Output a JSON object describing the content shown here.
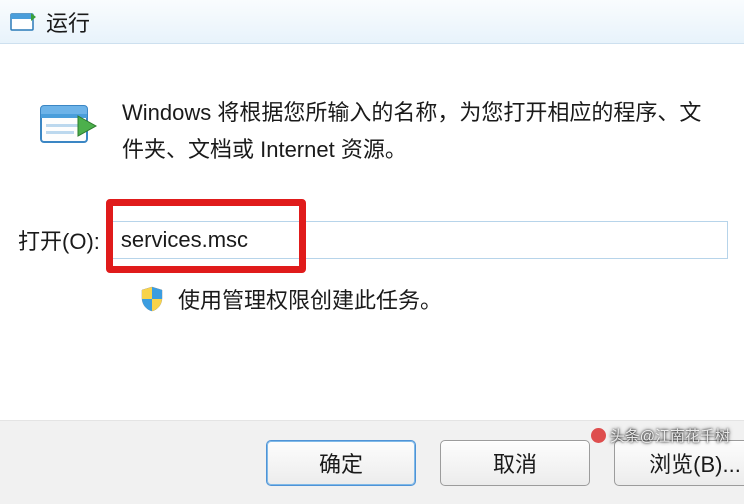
{
  "titlebar": {
    "title": "运行"
  },
  "description": "Windows 将根据您所输入的名称，为您打开相应的程序、文件夹、文档或 Internet 资源。",
  "open": {
    "label": "打开(O):",
    "value": "services.msc"
  },
  "admin_note": "使用管理权限创建此任务。",
  "buttons": {
    "ok": "确定",
    "cancel": "取消",
    "browse": "浏览(B)..."
  },
  "watermark": "头条@江南花千树"
}
